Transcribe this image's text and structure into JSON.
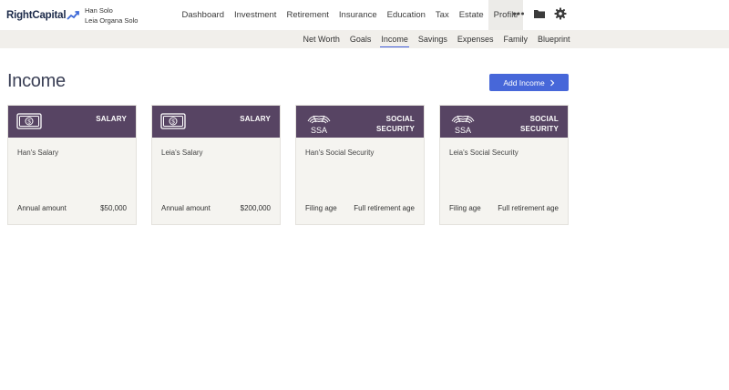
{
  "app": {
    "logo": "RightCapital",
    "brand_color": "#1c2a4a",
    "accent_color": "#4767d9",
    "card_header_color": "#574463"
  },
  "clients": {
    "primary": "Han Solo",
    "secondary": "Leia Organa Solo"
  },
  "main_nav": {
    "items": [
      {
        "label": "Dashboard"
      },
      {
        "label": "Investment"
      },
      {
        "label": "Retirement"
      },
      {
        "label": "Insurance"
      },
      {
        "label": "Education"
      },
      {
        "label": "Tax"
      },
      {
        "label": "Estate"
      },
      {
        "label": "Profile",
        "active": true
      }
    ],
    "icons": [
      "more-icon",
      "folder-icon",
      "gear-icon"
    ]
  },
  "sub_nav": {
    "items": [
      {
        "label": "Net Worth"
      },
      {
        "label": "Goals"
      },
      {
        "label": "Income",
        "active": true
      },
      {
        "label": "Savings"
      },
      {
        "label": "Expenses"
      },
      {
        "label": "Family"
      },
      {
        "label": "Blueprint"
      }
    ]
  },
  "page": {
    "title": "Income",
    "add_button": "Add Income"
  },
  "cards": [
    {
      "type_line1": "SALARY",
      "type_line2": "",
      "icon": "cash-icon",
      "name": "Han's Salary",
      "left": "Annual amount",
      "right": "$50,000"
    },
    {
      "type_line1": "SALARY",
      "type_line2": "",
      "icon": "cash-icon",
      "name": "Leia's Salary",
      "left": "Annual amount",
      "right": "$200,000"
    },
    {
      "type_line1": "SOCIAL",
      "type_line2": "SECURITY",
      "icon": "ssa-icon",
      "icon_text": "SSA",
      "name": "Han's Social Security",
      "left": "Filing age",
      "right": "Full retirement age"
    },
    {
      "type_line1": "SOCIAL",
      "type_line2": "SECURITY",
      "icon": "ssa-icon",
      "icon_text": "SSA",
      "name": "Leia's Social Security",
      "left": "Filing age",
      "right": "Full retirement age"
    }
  ]
}
